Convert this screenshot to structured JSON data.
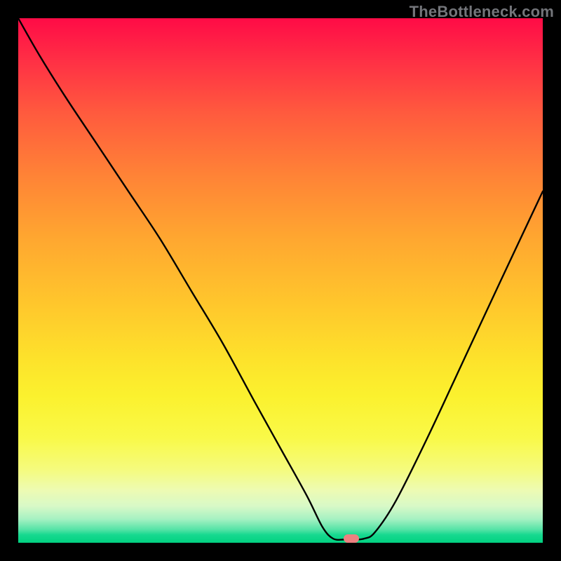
{
  "watermark": "TheBottleneck.com",
  "marker": {
    "x_pct": 63.5,
    "y_pct": 99.2
  },
  "chart_data": {
    "type": "line",
    "title": "",
    "xlabel": "",
    "ylabel": "",
    "xlim": [
      0,
      100
    ],
    "ylim": [
      0,
      100
    ],
    "grid": false,
    "legend": false,
    "gradient_stops": [
      {
        "pct": 0,
        "color": "#ff0b46"
      },
      {
        "pct": 8,
        "color": "#ff2f45"
      },
      {
        "pct": 18,
        "color": "#ff5a3e"
      },
      {
        "pct": 30,
        "color": "#ff8336"
      },
      {
        "pct": 42,
        "color": "#ffa730"
      },
      {
        "pct": 55,
        "color": "#ffc82c"
      },
      {
        "pct": 65,
        "color": "#fde22b"
      },
      {
        "pct": 72,
        "color": "#fbf12e"
      },
      {
        "pct": 80,
        "color": "#f9f948"
      },
      {
        "pct": 86,
        "color": "#f5fb7d"
      },
      {
        "pct": 90,
        "color": "#edfbb3"
      },
      {
        "pct": 93,
        "color": "#d8f9c7"
      },
      {
        "pct": 95.5,
        "color": "#a5f1c2"
      },
      {
        "pct": 97.5,
        "color": "#54e3a6"
      },
      {
        "pct": 98.5,
        "color": "#16d98f"
      },
      {
        "pct": 100,
        "color": "#02d181"
      }
    ],
    "series": [
      {
        "name": "bottleneck-curve",
        "x": [
          0,
          4,
          9,
          15,
          21,
          27,
          33,
          39,
          45,
          50,
          55,
          58,
          60,
          62,
          64,
          66,
          68,
          72,
          78,
          85,
          92,
          100
        ],
        "y": [
          100,
          93,
          85,
          76,
          67,
          58,
          48,
          38,
          27,
          18,
          9,
          3,
          0.8,
          0.6,
          0.6,
          0.8,
          2,
          8,
          20,
          35,
          50,
          67
        ]
      }
    ],
    "optimal_point": {
      "x": 63.5,
      "y": 0.6
    }
  }
}
